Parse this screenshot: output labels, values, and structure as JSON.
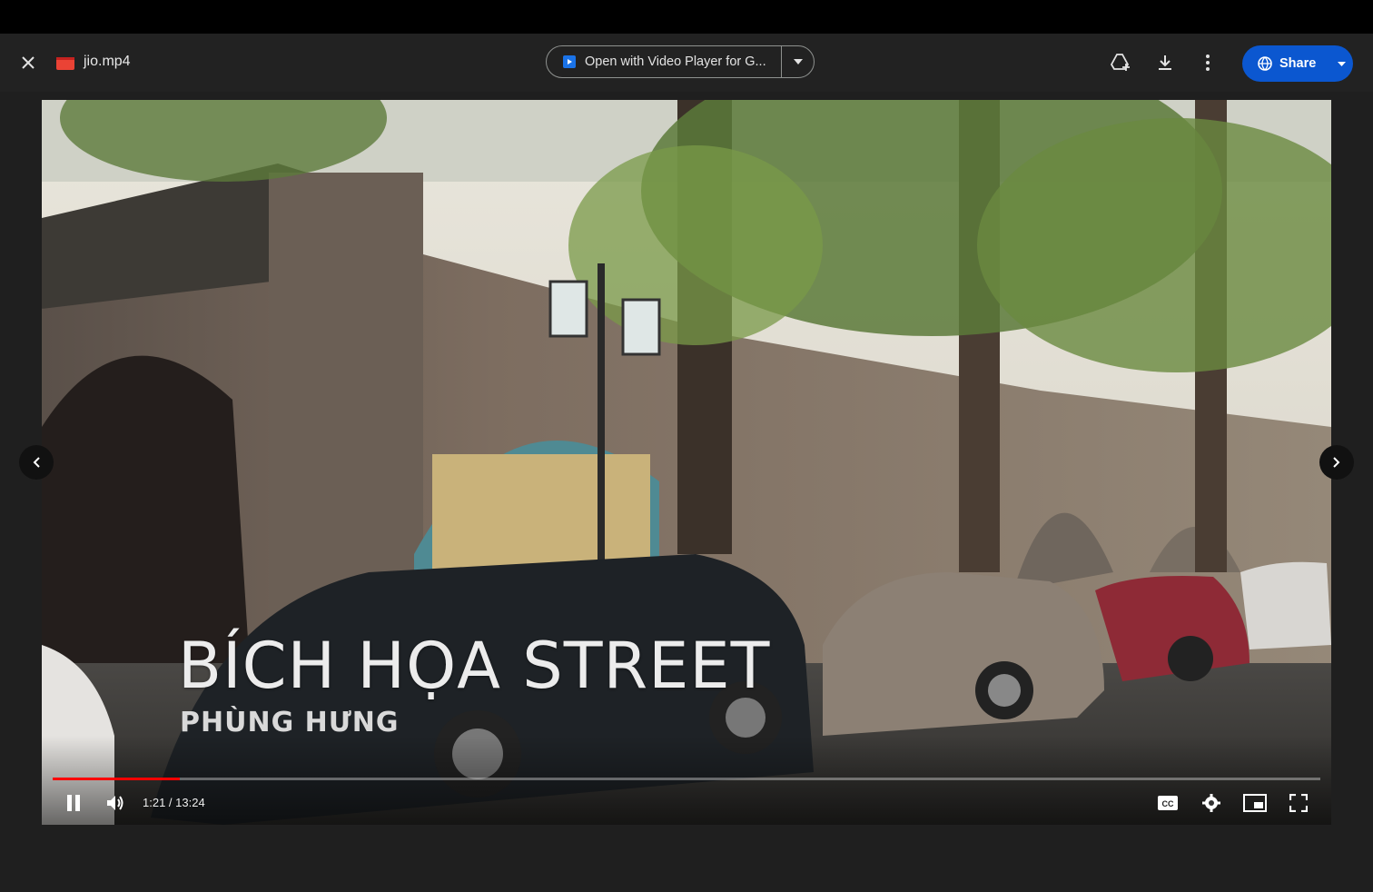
{
  "file": {
    "name": "jio.mp4",
    "icon": "video-file-icon"
  },
  "toolbar": {
    "open_with_label": "Open with Video Player for G...",
    "share_label": "Share",
    "icons": [
      "close-icon",
      "add-to-drive-icon",
      "download-icon",
      "more-vert-icon",
      "globe-icon"
    ]
  },
  "video": {
    "overlay_title": "BÍCH HỌA STREET",
    "overlay_subtitle": "PHÙNG HƯNG",
    "time": "1:21 / 13:24",
    "progress_fraction": 0.1,
    "state": "playing"
  },
  "colors": {
    "accent": "#0b57d0",
    "progress": "#ff0000",
    "background": "#1f1f1f"
  }
}
